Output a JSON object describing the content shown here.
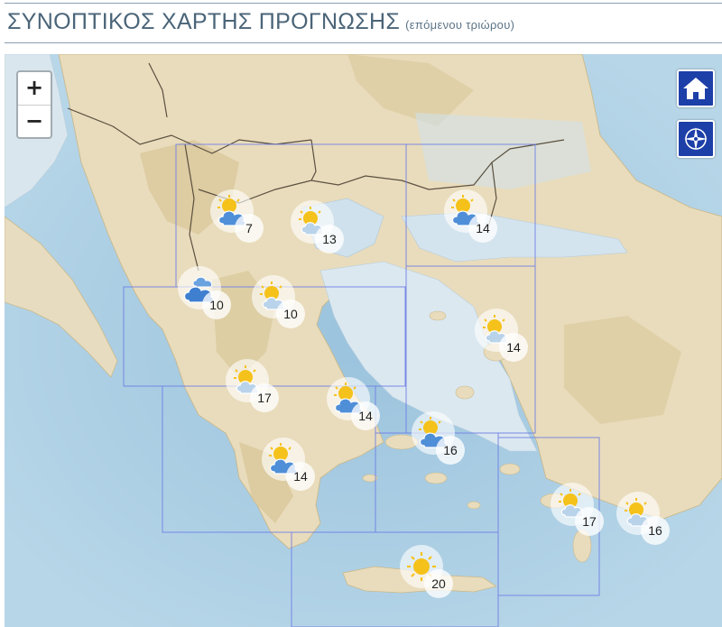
{
  "header": {
    "title": "ΣΥΝΟΠΤΙΚΟΣ ΧΑΡΤΗΣ ΠΡΟΓΝΩΣΗΣ",
    "subtitle": "(επόμενου τριώρου)"
  },
  "map_controls": {
    "zoom_in_label": "+",
    "zoom_out_label": "−",
    "home_icon": "home-icon",
    "locate_icon": "compass-icon",
    "button_color": "#1d3fa8"
  },
  "legend_colors": {
    "sea": "#a9cce2",
    "land": "#e9dcbc",
    "sun": "#f5c21b",
    "cloud": "#4f8fd8"
  },
  "forecasts": [
    {
      "id": "r1",
      "temp": "7",
      "icon": "partly-cloudy"
    },
    {
      "id": "r2",
      "temp": "13",
      "icon": "sun-light-cloud"
    },
    {
      "id": "r3",
      "temp": "14",
      "icon": "partly-cloudy"
    },
    {
      "id": "r4",
      "temp": "10",
      "icon": "cloudy"
    },
    {
      "id": "r5",
      "temp": "10",
      "icon": "sun-light-cloud"
    },
    {
      "id": "r6",
      "temp": "14",
      "icon": "sun-light-cloud"
    },
    {
      "id": "r7",
      "temp": "17",
      "icon": "sun-light-cloud"
    },
    {
      "id": "r8",
      "temp": "14",
      "icon": "partly-cloudy"
    },
    {
      "id": "r9",
      "temp": "16",
      "icon": "partly-cloudy"
    },
    {
      "id": "r10",
      "temp": "14",
      "icon": "partly-cloudy"
    },
    {
      "id": "r11",
      "temp": "17",
      "icon": "sun-light-cloud"
    },
    {
      "id": "r12",
      "temp": "16",
      "icon": "sun-light-cloud"
    },
    {
      "id": "r13",
      "temp": "20",
      "icon": "sunny"
    }
  ]
}
